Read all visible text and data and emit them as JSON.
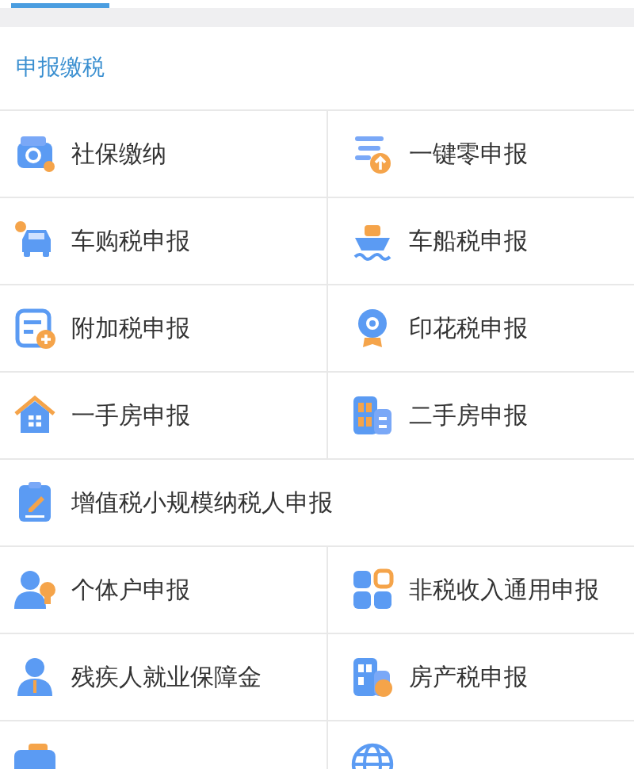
{
  "section": {
    "title": "申报缴税"
  },
  "rows": [
    {
      "items": [
        {
          "label": "社保缴纳"
        },
        {
          "label": "一键零申报"
        }
      ]
    },
    {
      "items": [
        {
          "label": "车购税申报"
        },
        {
          "label": "车船税申报"
        }
      ]
    },
    {
      "items": [
        {
          "label": "附加税申报"
        },
        {
          "label": "印花税申报"
        }
      ]
    },
    {
      "items": [
        {
          "label": "一手房申报"
        },
        {
          "label": "二手房申报"
        }
      ]
    },
    {
      "items": [
        {
          "label": "增值税小规模纳税人申报"
        }
      ]
    },
    {
      "items": [
        {
          "label": "个体户申报"
        },
        {
          "label": "非税收入通用申报"
        }
      ]
    },
    {
      "items": [
        {
          "label": "残疾人就业保障金"
        },
        {
          "label": "房产税申报"
        }
      ]
    }
  ]
}
